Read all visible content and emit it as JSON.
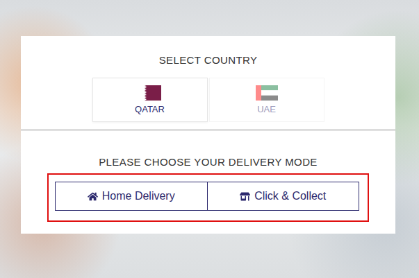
{
  "country_section": {
    "title": "SELECT COUNTRY",
    "countries": [
      {
        "label": "QATAR",
        "selected": true
      },
      {
        "label": "UAE",
        "selected": false
      }
    ]
  },
  "delivery_section": {
    "title": "PLEASE CHOOSE YOUR DELIVERY MODE",
    "highlighted": true,
    "options": [
      {
        "label": "Home Delivery"
      },
      {
        "label": "Click & Collect"
      }
    ]
  }
}
